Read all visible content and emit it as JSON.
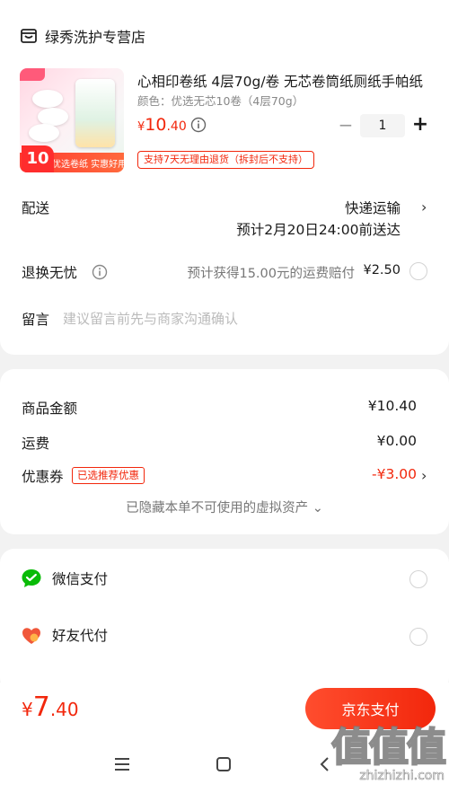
{
  "store": {
    "name": "绿秀洗护专营店",
    "icon": "store-icon"
  },
  "product": {
    "title": "心相印卷纸 4层70g/卷 无芯卷筒纸厕纸手帕纸",
    "variant": "颜色：优选无芯10卷（4层70g）",
    "price_symbol": "¥",
    "price_int": "10",
    "price_dec": ".40",
    "quantity": "1",
    "minus": "−",
    "plus": "+",
    "return_policy": "支持7天无理由退货（拆封后不支持）",
    "thumb_count": "10",
    "thumb_caption": "优选卷纸 实惠好用"
  },
  "delivery": {
    "label": "配送",
    "method": "快递运输",
    "eta": "预计2月20日24:00前送达"
  },
  "exchange": {
    "label": "退换无忧",
    "desc": "预计获得15.00元的运费赔付",
    "price": "¥2.50"
  },
  "note": {
    "label": "留言",
    "placeholder": "建议留言前先与商家沟通确认"
  },
  "summary": {
    "goods_label": "商品金额",
    "goods_value": "¥10.40",
    "shipping_label": "运费",
    "shipping_value": "¥0.00",
    "coupon_label": "优惠券",
    "coupon_tag": "已选推荐优惠",
    "coupon_value": "-¥3.00",
    "hidden_assets": "已隐藏本单不可使用的虚拟资产 ⌄"
  },
  "payment": [
    {
      "label": "微信支付",
      "icon": "wechat-pay-icon"
    },
    {
      "label": "好友代付",
      "icon": "friend-pay-heart-icon"
    }
  ],
  "footer": {
    "total_symbol": "¥",
    "total_int": "7",
    "total_dec": ".40",
    "pay_button": "京东支付"
  },
  "watermark": {
    "big": "值值值",
    "small": "zhizhizhi.com"
  },
  "colors": {
    "accent": "#f2270c",
    "wechat": "#09bb07"
  }
}
